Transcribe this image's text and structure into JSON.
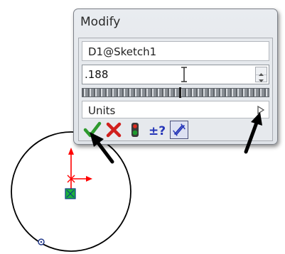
{
  "dialog": {
    "title": "Modify",
    "dimension_name": "D1@Sketch1",
    "value": ".188",
    "units_label": "Units"
  },
  "toolbar": {
    "buttons": [
      {
        "icon": "ok-checkmark-icon",
        "color": "#2e9a2e"
      },
      {
        "icon": "cancel-x-icon",
        "color": "#d0201e"
      },
      {
        "icon": "rebuild-traffic-light-icon",
        "color": "#1e9a2e"
      },
      {
        "icon": "reverse-dimension-icon",
        "color": "#2636b8"
      },
      {
        "icon": "mark-for-drawing-icon",
        "color": "#2636b8"
      }
    ]
  },
  "colors": {
    "sketch_line": "#000000",
    "sketch_axis": "#ff0000",
    "annotation_arrow": "#000000"
  }
}
